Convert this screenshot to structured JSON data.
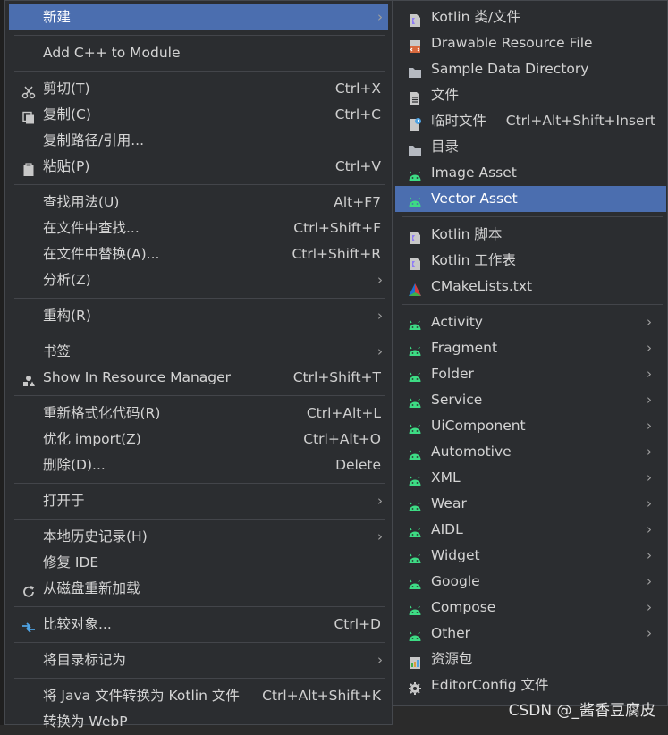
{
  "menu1": {
    "items": [
      {
        "label": "新建",
        "arrow": true
      },
      {
        "label": "Add C++ to Module"
      },
      {
        "label": "剪切(T)",
        "shortcut": "Ctrl+X",
        "icon": "scissors-icon"
      },
      {
        "label": "复制(C)",
        "shortcut": "Ctrl+C",
        "icon": "copy-icon"
      },
      {
        "label": "复制路径/引用..."
      },
      {
        "label": "粘贴(P)",
        "shortcut": "Ctrl+V",
        "icon": "paste-icon"
      },
      {
        "label": "查找用法(U)",
        "shortcut": "Alt+F7"
      },
      {
        "label": "在文件中查找...",
        "shortcut": "Ctrl+Shift+F"
      },
      {
        "label": "在文件中替换(A)...",
        "shortcut": "Ctrl+Shift+R"
      },
      {
        "label": "分析(Z)",
        "arrow": true
      },
      {
        "label": "重构(R)",
        "arrow": true
      },
      {
        "label": "书签",
        "arrow": true
      },
      {
        "label": "Show In Resource Manager",
        "shortcut": "Ctrl+Shift+T",
        "icon": "resource-manager-icon"
      },
      {
        "label": "重新格式化代码(R)",
        "shortcut": "Ctrl+Alt+L"
      },
      {
        "label": "优化 import(Z)",
        "shortcut": "Ctrl+Alt+O"
      },
      {
        "label": "删除(D)...",
        "shortcut": "Delete"
      },
      {
        "label": "打开于",
        "arrow": true
      },
      {
        "label": "本地历史记录(H)",
        "arrow": true
      },
      {
        "label": "修复 IDE"
      },
      {
        "label": "从磁盘重新加载",
        "icon": "reload-icon"
      },
      {
        "label": "比较对象...",
        "shortcut": "Ctrl+D",
        "icon": "compare-icon"
      },
      {
        "label": "将目录标记为",
        "arrow": true
      },
      {
        "label": "将 Java 文件转换为 Kotlin 文件",
        "shortcut": "Ctrl+Alt+Shift+K"
      },
      {
        "label": "转换为 WebP"
      }
    ]
  },
  "menu2": {
    "items": [
      {
        "label": "Kotlin 类/文件",
        "icon": "kotlin-file-icon"
      },
      {
        "label": "Drawable Resource File",
        "icon": "drawable-resource-icon"
      },
      {
        "label": "Sample Data Directory",
        "icon": "folder-icon"
      },
      {
        "label": "文件",
        "icon": "file-icon"
      },
      {
        "label": "临时文件",
        "shortcut": "Ctrl+Alt+Shift+Insert",
        "icon": "scratch-file-icon"
      },
      {
        "label": "目录",
        "icon": "folder-icon"
      },
      {
        "label": "Image Asset",
        "icon": "android-icon"
      },
      {
        "label": "Vector Asset",
        "icon": "android-icon"
      },
      {
        "label": "Kotlin 脚本",
        "icon": "kotlin-script-icon"
      },
      {
        "label": "Kotlin 工作表",
        "icon": "kotlin-worksheet-icon"
      },
      {
        "label": "CMakeLists.txt",
        "icon": "cmake-icon"
      },
      {
        "label": "Activity",
        "arrow": true,
        "icon": "android-icon"
      },
      {
        "label": "Fragment",
        "arrow": true,
        "icon": "android-icon"
      },
      {
        "label": "Folder",
        "arrow": true,
        "icon": "android-icon"
      },
      {
        "label": "Service",
        "arrow": true,
        "icon": "android-icon"
      },
      {
        "label": "UiComponent",
        "arrow": true,
        "icon": "android-icon"
      },
      {
        "label": "Automotive",
        "arrow": true,
        "icon": "android-icon"
      },
      {
        "label": "XML",
        "arrow": true,
        "icon": "android-icon"
      },
      {
        "label": "Wear",
        "arrow": true,
        "icon": "android-icon"
      },
      {
        "label": "AIDL",
        "arrow": true,
        "icon": "android-icon"
      },
      {
        "label": "Widget",
        "arrow": true,
        "icon": "android-icon"
      },
      {
        "label": "Google",
        "arrow": true,
        "icon": "android-icon"
      },
      {
        "label": "Compose",
        "arrow": true,
        "icon": "android-icon"
      },
      {
        "label": "Other",
        "arrow": true,
        "icon": "android-icon"
      },
      {
        "label": "资源包",
        "icon": "resource-bundle-icon"
      },
      {
        "label": "EditorConfig 文件",
        "icon": "gear-icon"
      }
    ]
  },
  "arrow_glyph": "›",
  "watermark": "CSDN @_酱香豆腐皮",
  "colors": {
    "menu_bg": "#2b2d30",
    "selected_bg": "#4b6eaf",
    "android_green": "#3ddc84",
    "kotlin_purple": "#8f7cf6"
  }
}
